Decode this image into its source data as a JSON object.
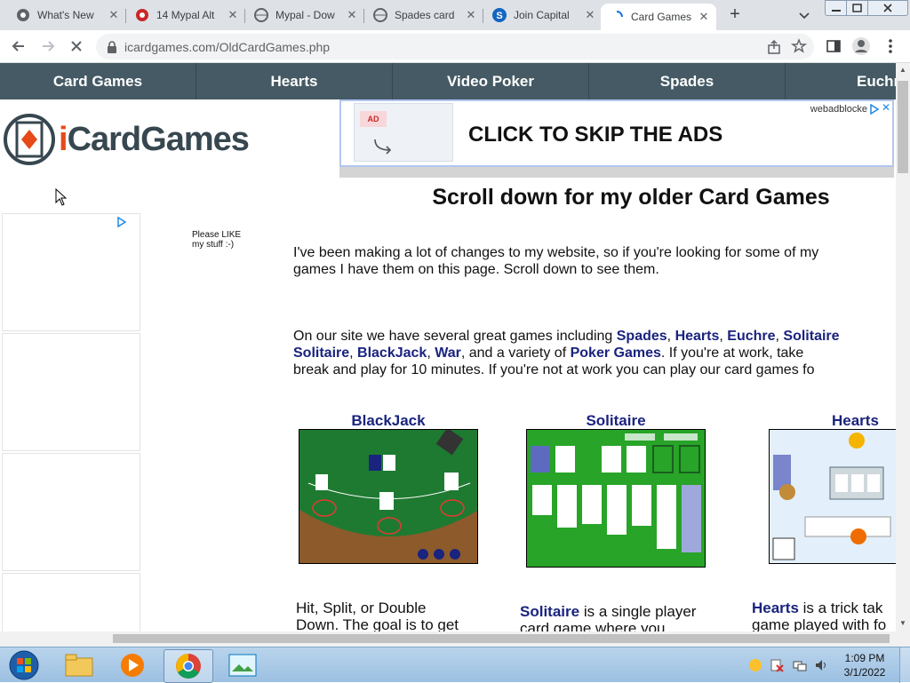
{
  "browser": {
    "tabs": [
      {
        "title": "What's New",
        "icon": "chrome-icon"
      },
      {
        "title": "14 Mypal Alt",
        "icon": "mypal-icon"
      },
      {
        "title": "Mypal - Dow",
        "icon": "globe-icon"
      },
      {
        "title": "Spades card",
        "icon": "globe-icon"
      },
      {
        "title": "Join Capital",
        "icon": "s-icon"
      },
      {
        "title": "Card Games",
        "icon": "loading-icon",
        "active": true
      }
    ],
    "new_tab": "+",
    "url": "icardgames.com/OldCardGames.php"
  },
  "page": {
    "nav": [
      "Card Games",
      "Hearts",
      "Video Poker",
      "Spades",
      "Euchre"
    ],
    "logo": {
      "prefix": "i",
      "rest": "CardGames"
    },
    "ad": {
      "text": "CLICK TO SKIP THE ADS",
      "source": "webadblocke",
      "tag": "AD"
    },
    "heading": "Scroll down for my older Card Games",
    "like_text_1": "Please LIKE",
    "like_text_2": "my stuff :-)",
    "intro_line1": "I've been making a lot of changes to my website, so if you're looking for some of my",
    "intro_line2": "games I have them on this page. Scroll down to see them.",
    "p2_l1_a": "On our site we have several great games including ",
    "p2_links": [
      "Spades",
      "Hearts",
      "Euchre",
      "Solitaire",
      "Solitaire",
      "BlackJack",
      "War",
      "Poker Games"
    ],
    "p2_l1_sep": ", ",
    "p2_l2_mid": ", and a variety of ",
    "p2_l2_end": ". If you're at work, take",
    "p2_l3": "break and play for 10 minutes. If you're not at work you can play our card games fo",
    "games": [
      {
        "title": "BlackJack",
        "desc1": "Hit, Split, or Double",
        "desc2": "Down. The goal is to get"
      },
      {
        "title": "Solitaire",
        "desc_bold": "Solitaire",
        "desc1": " is a single player",
        "desc2": "card game where you"
      },
      {
        "title": "Hearts",
        "desc_bold": "Hearts",
        "desc1": " is a trick tak",
        "desc2": "game played with fo"
      }
    ]
  },
  "taskbar": {
    "apps": [
      "start-orb",
      "file-explorer-icon",
      "media-player-icon",
      "chrome-icon",
      "image-viewer-icon"
    ],
    "time": "1:09 PM",
    "date": "3/1/2022"
  }
}
